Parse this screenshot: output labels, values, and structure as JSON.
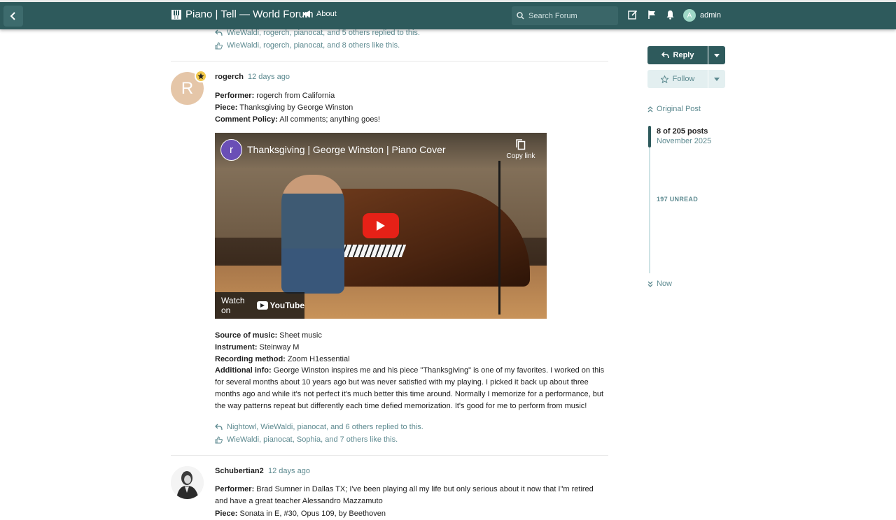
{
  "header": {
    "site_title": "Piano | Tell — World Forum",
    "about_label": "About",
    "search_placeholder": "Search Forum",
    "username": "admin",
    "user_initial": "A"
  },
  "previous_post": {
    "replied_text": "WieWaldi, rogerch, pianocat, and 5 others replied to this.",
    "likes_text": "WieWaldi, rogerch, pianocat, and 8 others like this."
  },
  "post_rogerch": {
    "avatar_initial": "R",
    "username": "rogerch",
    "date": "12 days ago",
    "performer_label": "Performer:",
    "performer_value": " rogerch from California",
    "piece_label": "Piece:",
    "piece_value": " Thanksgiving by George Winston",
    "policy_label": "Comment Policy:",
    "policy_value": " All comments; anything goes!",
    "video": {
      "channel_initial": "r",
      "title": "Thanksgiving | George Winston | Piano Cover",
      "copy_link": "Copy link",
      "watch_on": "Watch on",
      "youtube": "YouTube"
    },
    "source_label": "Source of music:",
    "source_value": " Sheet music",
    "instrument_label": "Instrument:",
    "instrument_value": " Steinway M",
    "recording_label": "Recording method:",
    "recording_value": " Zoom H1essential",
    "info_label": "Additional info:",
    "info_value": " George Winston inspires me and his piece \"Thanksgiving\" is one of my favorites. I worked on this for several months about 10 years ago but was never satisfied with my playing. I picked it back up about three months ago and while it's not perfect it's much better this time around. Normally I memorize for a performance, but the way patterns repeat but differently each time defied memorization. It's good for me to perform from music!",
    "replied_text": "Nightowl, WieWaldi, pianocat, and 6 others replied to this.",
    "likes_text": "WieWaldi, pianocat, Sophia, and 7 others like this."
  },
  "post_schubertian": {
    "username": "Schubertian2",
    "date": "12 days ago",
    "performer_label": "Performer:",
    "performer_value": " Brad Sumner in Dallas TX; I've been playing all my life but only serious about it now that I\"m retired and have a great teacher Alessandro Mazzamuto",
    "piece_label": "Piece:",
    "piece_value": " Sonata in E, #30, Opus 109, by Beethoven"
  },
  "sidebar": {
    "reply_label": "Reply",
    "follow_label": "Follow",
    "original_post": "Original Post",
    "post_count": "8 of 205 posts",
    "post_date": "November 2025",
    "unread": "197 UNREAD",
    "now": "Now"
  },
  "colors": {
    "header_bg": "#2e5a5c",
    "link": "#5d8a90",
    "avatar_r": "#e5c6a8",
    "follow_bg": "#e3eff0"
  }
}
